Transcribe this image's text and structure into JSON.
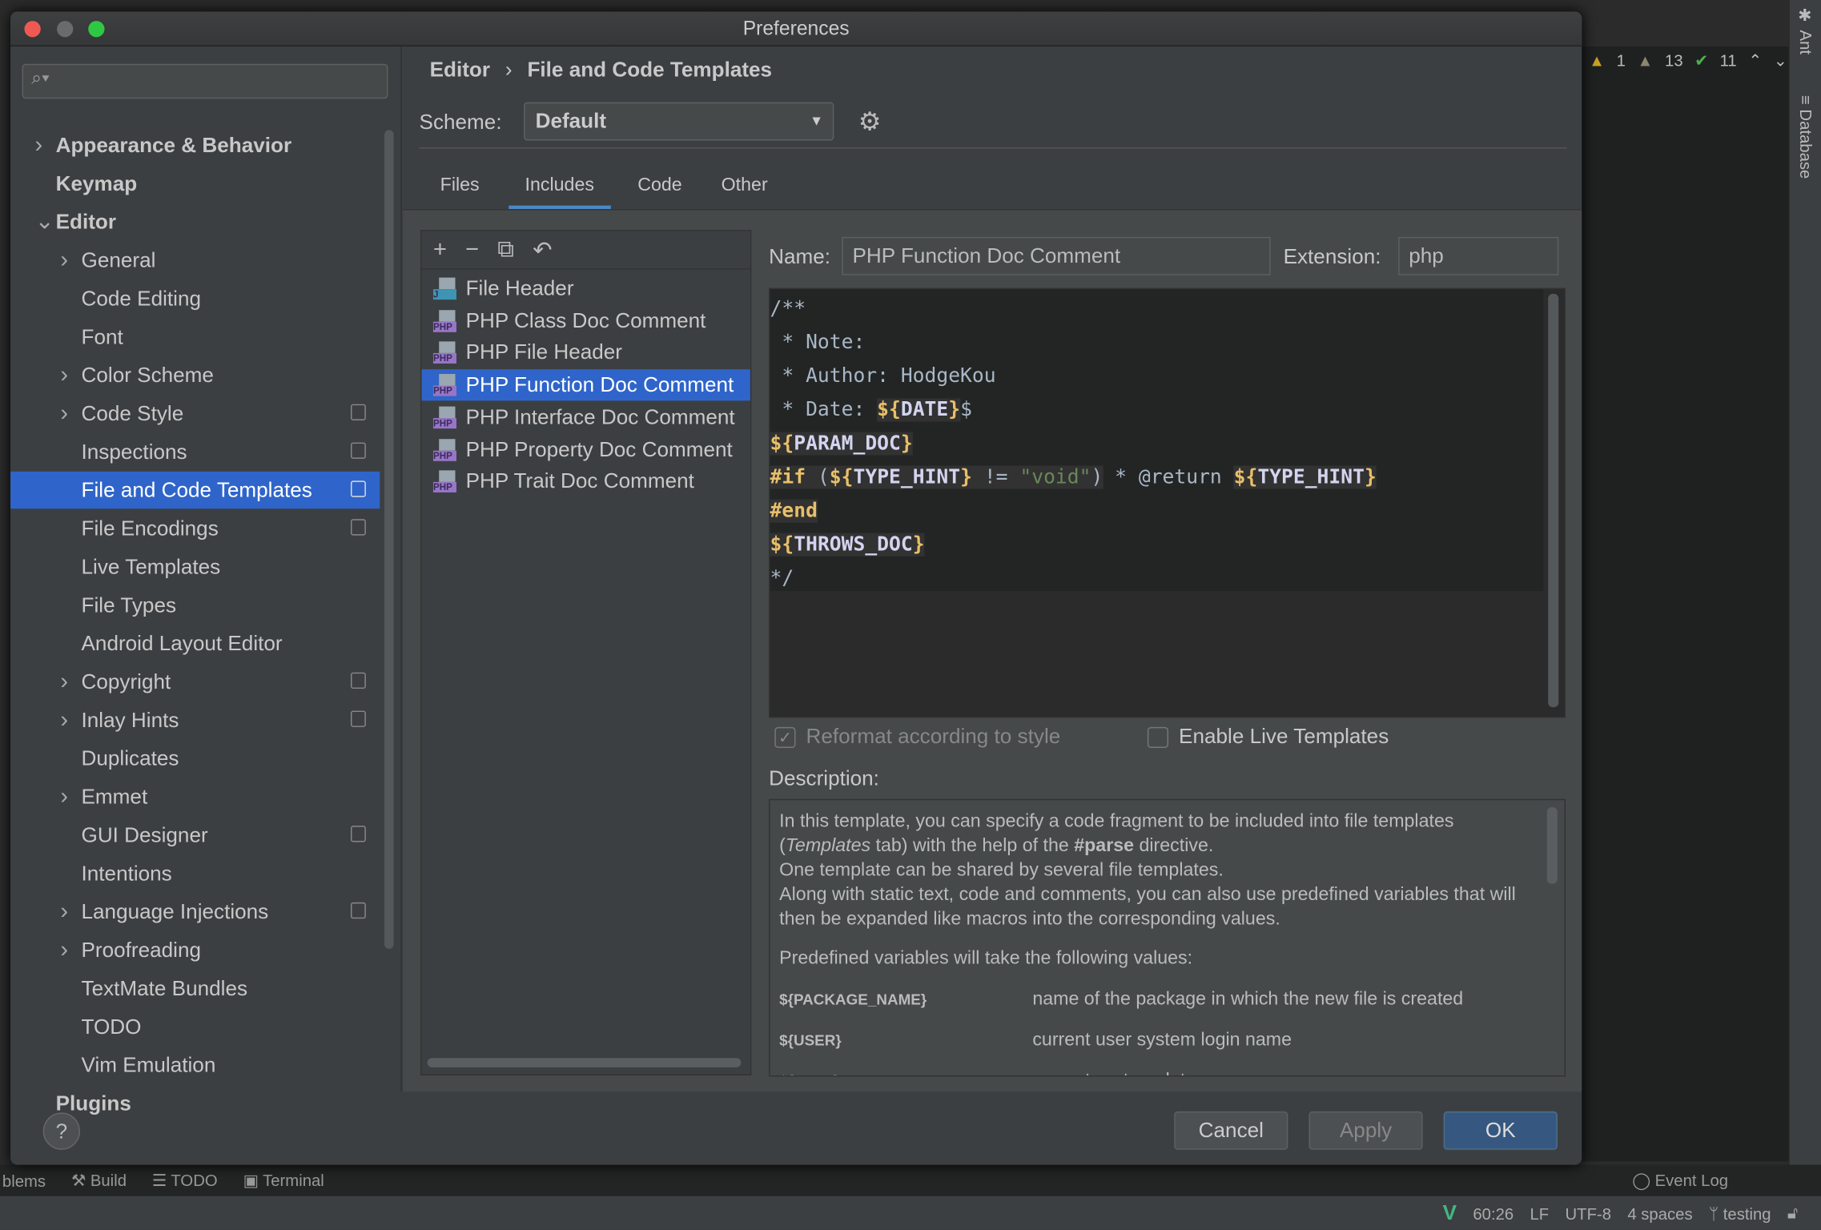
{
  "window": {
    "title": "Preferences"
  },
  "ide": {
    "inspections": {
      "errors": "1",
      "warnings": "13",
      "ok": "11"
    },
    "right_tools": [
      "Ant",
      "Database"
    ],
    "bottom_tools": [
      "blems",
      "Build",
      "TODO",
      "Terminal"
    ],
    "event_log": "Event Log",
    "status": {
      "position": "60:26",
      "line_sep": "LF",
      "encoding": "UTF-8",
      "indent": "4 spaces",
      "branch": "testing"
    }
  },
  "sidebar": {
    "search_placeholder": "",
    "items": [
      {
        "label": "Appearance & Behavior",
        "level": 0,
        "chevron": "right",
        "copy": false
      },
      {
        "label": "Keymap",
        "level": 0,
        "chevron": "",
        "copy": false
      },
      {
        "label": "Editor",
        "level": 0,
        "chevron": "down",
        "copy": false
      },
      {
        "label": "General",
        "level": 1,
        "chevron": "right",
        "copy": false
      },
      {
        "label": "Code Editing",
        "level": 1,
        "chevron": "",
        "copy": false
      },
      {
        "label": "Font",
        "level": 1,
        "chevron": "",
        "copy": false
      },
      {
        "label": "Color Scheme",
        "level": 1,
        "chevron": "right",
        "copy": false
      },
      {
        "label": "Code Style",
        "level": 1,
        "chevron": "right",
        "copy": true
      },
      {
        "label": "Inspections",
        "level": 1,
        "chevron": "",
        "copy": true
      },
      {
        "label": "File and Code Templates",
        "level": 1,
        "chevron": "",
        "copy": true,
        "selected": true
      },
      {
        "label": "File Encodings",
        "level": 1,
        "chevron": "",
        "copy": true
      },
      {
        "label": "Live Templates",
        "level": 1,
        "chevron": "",
        "copy": false
      },
      {
        "label": "File Types",
        "level": 1,
        "chevron": "",
        "copy": false
      },
      {
        "label": "Android Layout Editor",
        "level": 1,
        "chevron": "",
        "copy": false
      },
      {
        "label": "Copyright",
        "level": 1,
        "chevron": "right",
        "copy": true
      },
      {
        "label": "Inlay Hints",
        "level": 1,
        "chevron": "right",
        "copy": true
      },
      {
        "label": "Duplicates",
        "level": 1,
        "chevron": "",
        "copy": false
      },
      {
        "label": "Emmet",
        "level": 1,
        "chevron": "right",
        "copy": false
      },
      {
        "label": "GUI Designer",
        "level": 1,
        "chevron": "",
        "copy": true
      },
      {
        "label": "Intentions",
        "level": 1,
        "chevron": "",
        "copy": false
      },
      {
        "label": "Language Injections",
        "level": 1,
        "chevron": "right",
        "copy": true
      },
      {
        "label": "Proofreading",
        "level": 1,
        "chevron": "right",
        "copy": false
      },
      {
        "label": "TextMate Bundles",
        "level": 1,
        "chevron": "",
        "copy": false
      },
      {
        "label": "TODO",
        "level": 1,
        "chevron": "",
        "copy": false
      },
      {
        "label": "Vim Emulation",
        "level": 1,
        "chevron": "",
        "copy": false
      },
      {
        "label": "Plugins",
        "level": 0,
        "chevron": "",
        "copy": false
      }
    ]
  },
  "breadcrumb": {
    "parent": "Editor",
    "separator": "›",
    "current": "File and Code Templates"
  },
  "scheme": {
    "label": "Scheme:",
    "value": "Default"
  },
  "tabs": [
    {
      "label": "Files"
    },
    {
      "label": "Includes",
      "selected": true
    },
    {
      "label": "Code"
    },
    {
      "label": "Other"
    }
  ],
  "templates": [
    {
      "label": "File Header",
      "badge": "J"
    },
    {
      "label": "PHP Class Doc Comment",
      "badge": "PHP"
    },
    {
      "label": "PHP File Header",
      "badge": "PHP"
    },
    {
      "label": "PHP Function Doc Comment",
      "badge": "PHP",
      "selected": true
    },
    {
      "label": "PHP Interface Doc Comment",
      "badge": "PHP"
    },
    {
      "label": "PHP Property Doc Comment",
      "badge": "PHP"
    },
    {
      "label": "PHP Trait Doc Comment",
      "badge": "PHP"
    }
  ],
  "form": {
    "name_label": "Name:",
    "name_value": "PHP Function Doc Comment",
    "ext_label": "Extension:",
    "ext_value": "php"
  },
  "code": {
    "l1": "/**",
    "l2": " * Note:",
    "l3": " * Author: HodgeKou",
    "l4a": " * Date: ",
    "l4v": "DATE",
    "l4b": "$",
    "l5v": "PARAM_DOC",
    "l6a": "#if",
    "l6b": " (",
    "l6v": "TYPE_HINT",
    "l6c": " != ",
    "l6s": "\"void\"",
    "l6d": ") * @return ",
    "l6v2": "TYPE_HINT",
    "l7": "#end",
    "l8v": "THROWS_DOC",
    "l9": "*/"
  },
  "options": {
    "reformat": "Reformat according to style",
    "reformat_checked": true,
    "live": "Enable Live Templates",
    "live_checked": false
  },
  "description": {
    "label": "Description:",
    "p1a": "In this template, you can specify a code fragment to be included into file templates (",
    "p1i": "Templates",
    "p1b": " tab) with the help of the ",
    "p1k": "#parse",
    "p1c": " directive.",
    "p2": "One template can be shared by several file templates.",
    "p3": "Along with static text, code and comments, you can also use predefined variables that will then be expanded like macros into the corresponding values.",
    "p4": "Predefined variables will take the following values:",
    "vars": [
      {
        "k": "${PACKAGE_NAME}",
        "v": "name of the package in which the new file is created"
      },
      {
        "k": "${USER}",
        "v": "current user system login name"
      },
      {
        "k": "${DATE}",
        "v": "current system date"
      }
    ]
  },
  "buttons": {
    "help": "?",
    "cancel": "Cancel",
    "apply": "Apply",
    "ok": "OK"
  },
  "colors": {
    "selection": "#2f65ca",
    "accent": "#365880",
    "variable": "#e8bf6a",
    "string": "#6a8759"
  }
}
